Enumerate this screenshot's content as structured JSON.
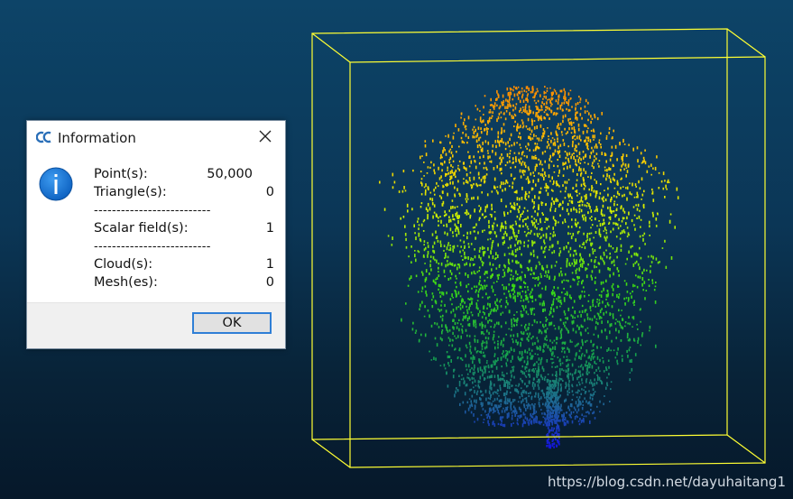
{
  "dialog": {
    "title": "Information",
    "app_icon": "cc-logo-icon",
    "close_icon": "close-icon",
    "info_icon": "info-icon",
    "rows": {
      "points": {
        "label": "Point(s):",
        "value": "50,000"
      },
      "triangles": {
        "label": "Triangle(s):",
        "value": "0"
      },
      "scalar_fields": {
        "label": "Scalar field(s):",
        "value": "1"
      },
      "clouds": {
        "label": "Cloud(s):",
        "value": "1"
      },
      "meshes": {
        "label": "Mesh(es):",
        "value": "0"
      }
    },
    "separator": "--------------------------",
    "ok_label": "OK"
  },
  "viewport": {
    "background_top": "#0d4468",
    "background_bottom": "#06182a",
    "bbox_color": "#ffff33"
  },
  "watermark": "https://blog.csdn.net/dayuhaitang1"
}
